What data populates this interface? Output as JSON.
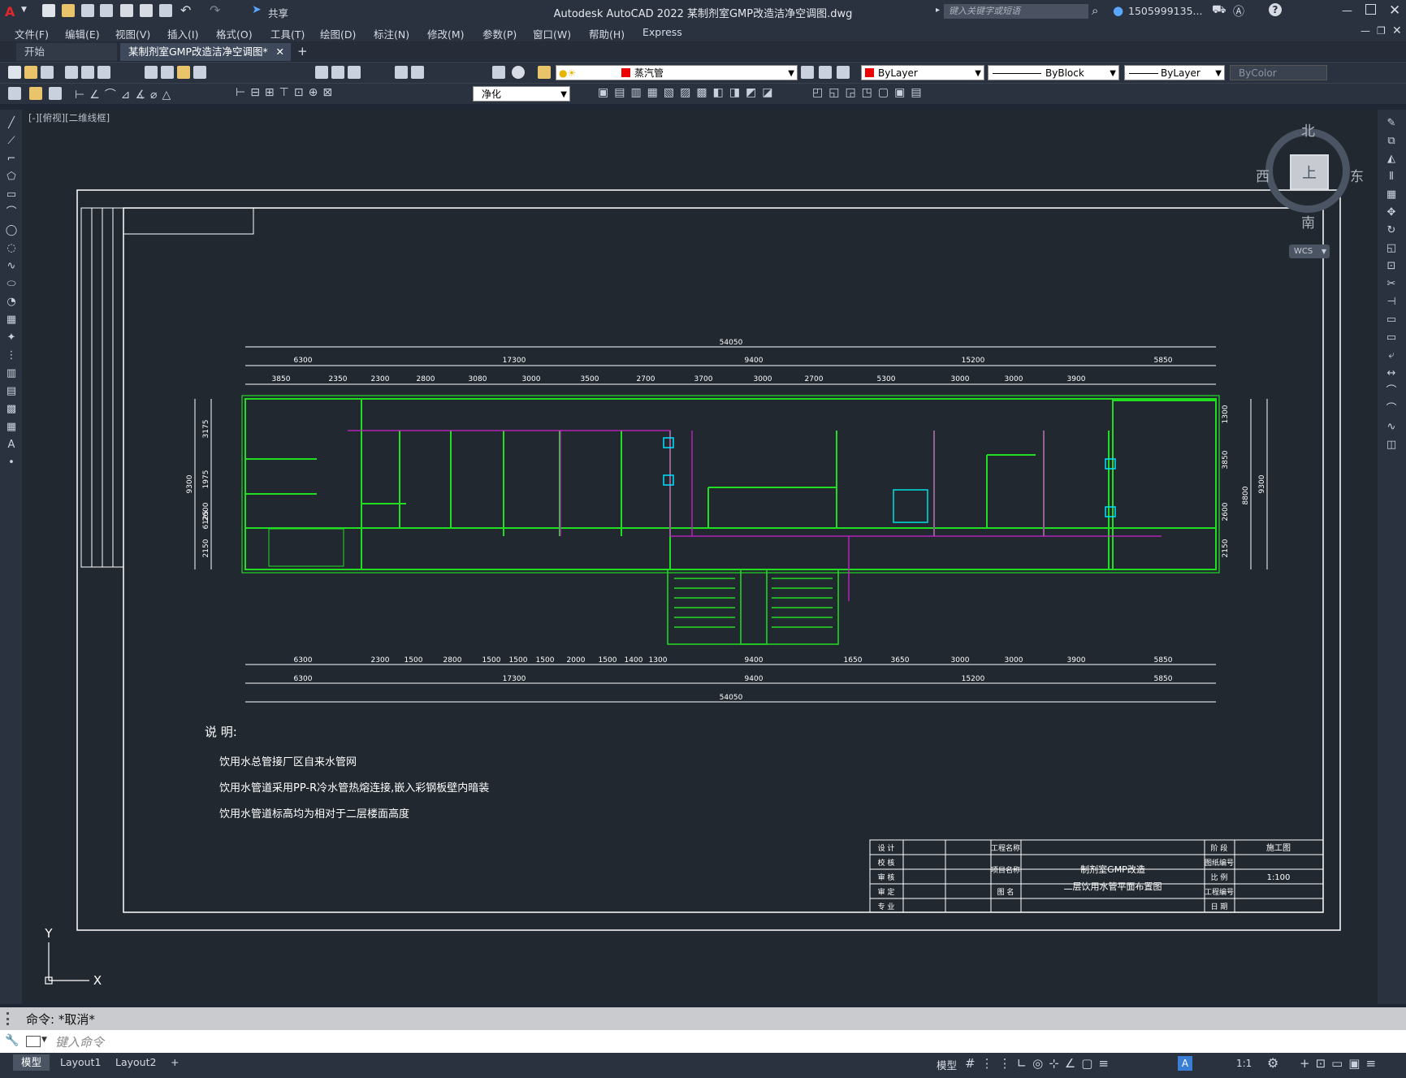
{
  "app": {
    "title": "Autodesk AutoCAD 2022    某制剂室GMP改造洁净空调图.dwg",
    "share": "共享",
    "search_placeholder": "键入关键字或短语",
    "user": "1505999135..."
  },
  "menu": [
    "文件(F)",
    "编辑(E)",
    "视图(V)",
    "插入(I)",
    "格式(O)",
    "工具(T)",
    "绘图(D)",
    "标注(N)",
    "修改(M)",
    "参数(P)",
    "窗口(W)",
    "帮助(H)",
    "Express"
  ],
  "tabs": {
    "start": "开始",
    "active": "某制剂室GMP改造洁净空调图*",
    "add": "+"
  },
  "toolbar": {
    "layer": "蒸汽管",
    "color": "ByLayer",
    "linetype": "ByBlock",
    "lineweight": "ByLayer",
    "plotstyle": "ByColor",
    "dimstyle": "净化"
  },
  "viewport": {
    "label": "[-][俯视][二维线框]"
  },
  "viewcube": {
    "north": "北",
    "south": "南",
    "east": "东",
    "west": "西",
    "top": "上",
    "wcs": "WCS"
  },
  "ucs": {
    "x": "X",
    "y": "Y"
  },
  "drawing": {
    "dims_top_total": "54050",
    "dims_top_l2": [
      "6300",
      "17300",
      "9400",
      "15200",
      "5850"
    ],
    "dims_top_l3": [
      "3850",
      "2350",
      "2300",
      "2800",
      "3080",
      "3000",
      "3500",
      "2700",
      "3700",
      "3000",
      "2700",
      "5300",
      "3000",
      "3000",
      "3900"
    ],
    "dims_bottom_l1": [
      "6300",
      "2300",
      "1500",
      "2800",
      "1500",
      "1500",
      "1500",
      "2000",
      "1500",
      "1400",
      "1300",
      "9400",
      "1650",
      "3650",
      "3000",
      "3000",
      "3900",
      "5850"
    ],
    "dims_bottom_l2": [
      "6300",
      "17300",
      "9400",
      "15200",
      "5850"
    ],
    "dims_bottom_total": "54050",
    "dims_left": [
      "3175",
      "1975",
      "2600",
      "2150"
    ],
    "dims_left_outer": [
      "9300",
      "6125"
    ],
    "dims_right": [
      "1300",
      "3850",
      "2600",
      "2150"
    ],
    "dims_right_outer": [
      "8800",
      "9300"
    ],
    "notes_title": "说  明:",
    "notes": [
      "饮用水总管接厂区自来水管网",
      "饮用水管道采用PP-R冷水管热熔连接,嵌入彩钢板壁内暗装",
      "饮用水管道标高均为相对于二层楼面高度"
    ],
    "titleblock": {
      "left_labels": [
        "设 计",
        "校 核",
        "审 核",
        "审 定",
        "专 业"
      ],
      "project_label": "工程名称",
      "sub_label": "项目名称",
      "drawing_label": "图 名",
      "project": "制剂室GMP改造",
      "drawing": "二层饮用水管平面布置图",
      "right_labels": [
        "阶 段",
        "图纸编号",
        "比 例",
        "工程编号",
        "日 期"
      ],
      "stage": "施工图",
      "scale": "1:100"
    }
  },
  "command": {
    "history": "命令:  *取消*",
    "placeholder": "键入命令"
  },
  "layout_tabs": [
    "模型",
    "Layout1",
    "Layout2",
    "+"
  ],
  "status": {
    "model": "模型",
    "scale": "1:1"
  }
}
